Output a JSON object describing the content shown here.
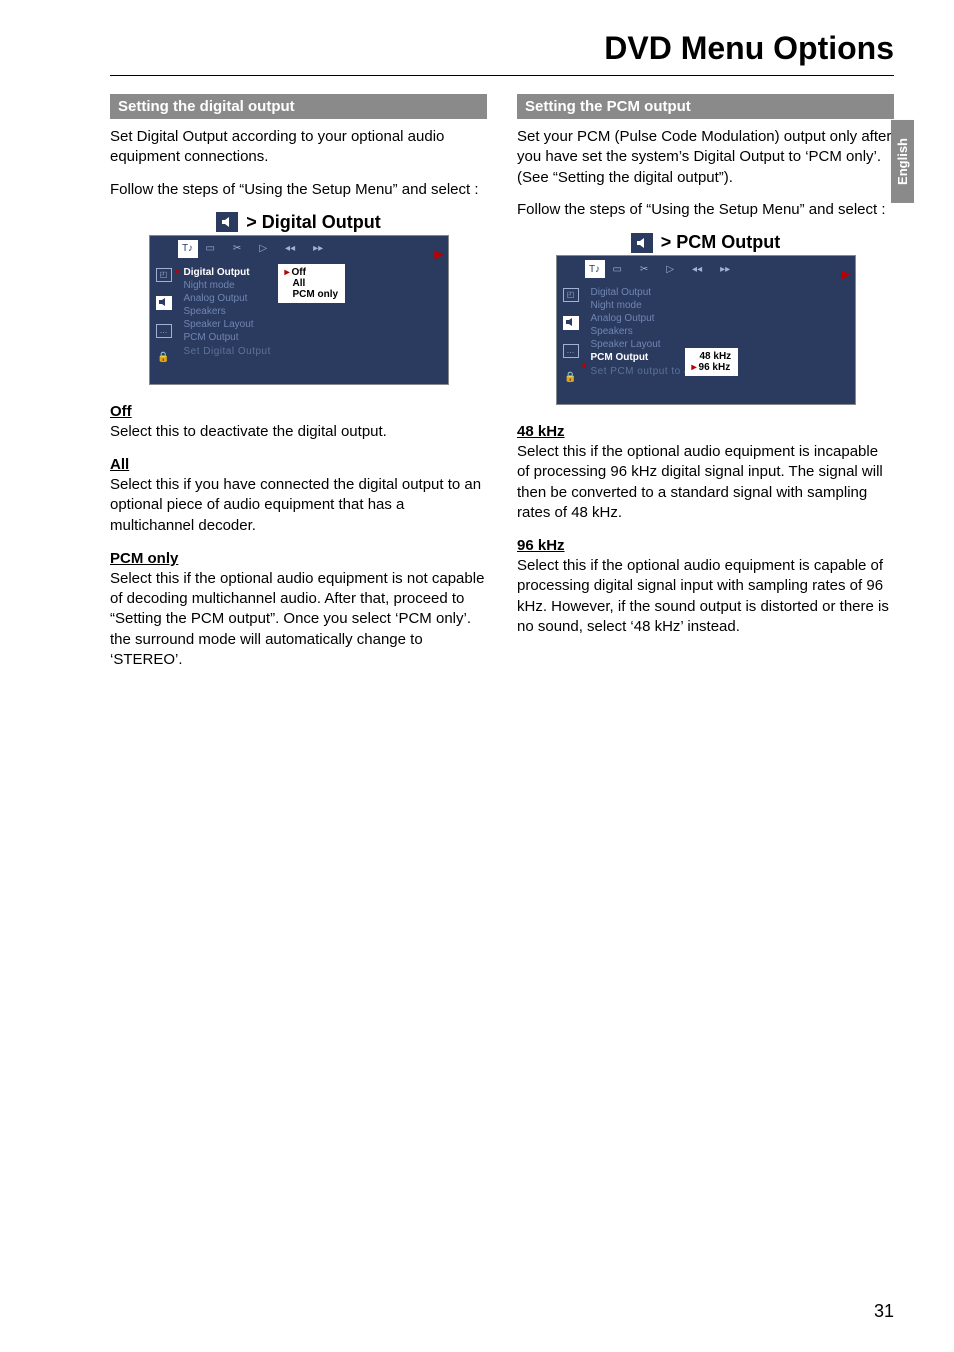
{
  "page_title": "DVD Menu Options",
  "language_tab": "English",
  "page_number": "31",
  "left": {
    "section_header": "Setting the digital output",
    "intro1": "Set Digital Output according to your optional audio equipment connections.",
    "intro2": "Follow the steps of “Using the Setup Menu” and select :",
    "figure": {
      "title": "> Digital Output",
      "top_tab_glyph": "T♪",
      "list": {
        "digital_output": "Digital Output",
        "night_mode": "Night mode",
        "analog_output": "Analog Output",
        "speakers": "Speakers",
        "speaker_layout": "Speaker Layout",
        "pcm_output": "PCM Output"
      },
      "hint": "Set Digital Output",
      "options": {
        "off": "Off",
        "all": "All",
        "pcm_only": "PCM only"
      }
    },
    "opt1_h": "Off",
    "opt1_t": "Select this to deactivate the digital output.",
    "opt2_h": "All",
    "opt2_t": "Select this if you have connected the digital output to an optional piece of audio equipment that has a multichannel decoder.",
    "opt3_h": "PCM only",
    "opt3_t": "Select this if the optional audio equipment is not capable of decoding multichannel audio. After that, proceed to “Setting the PCM output”.  Once you select ‘PCM only’. the surround mode will automatically change to ‘STEREO’."
  },
  "right": {
    "section_header": "Setting the PCM output",
    "intro1": "Set your PCM (Pulse Code Modulation) output only after you have set the system’s Digital Output to ‘PCM only’.  (See “Setting the digital output”).",
    "intro2": "Follow the steps of “Using the Setup Menu” and select :",
    "figure": {
      "title": "> PCM Output",
      "top_tab_glyph": "T♪",
      "list": {
        "digital_output": "Digital Output",
        "night_mode": "Night mode",
        "analog_output": "Analog Output",
        "speakers": "Speakers",
        "speaker_layout": "Speaker Layout",
        "pcm_output": "PCM Output"
      },
      "hint": "Set PCM output to 48K or 96K",
      "options": {
        "k48": "48 kHz",
        "k96": "96 kHz"
      }
    },
    "opt1_h": "48 kHz",
    "opt1_t": "Select this if the optional audio equipment is incapable of processing 96 kHz digital signal input.  The signal will then be converted to a standard signal with sampling rates of 48 kHz.",
    "opt2_h": "96 kHz",
    "opt2_t": "Select this if the optional audio equipment is capable of processing digital signal input with sampling rates of 96 kHz.  However, if the sound output is distorted or there is no sound, select ‘48 kHz’ instead."
  }
}
